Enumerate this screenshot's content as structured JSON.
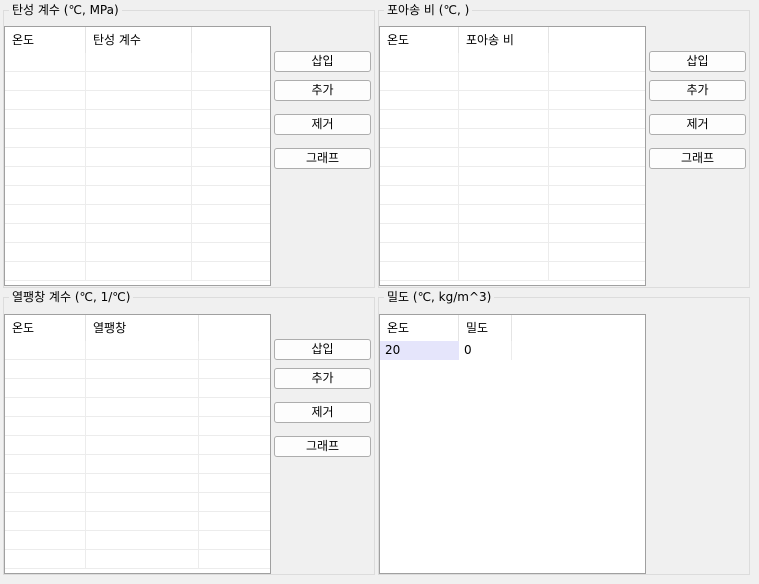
{
  "panels": {
    "elastic": {
      "title": "탄성 계수 (℃, MPa)",
      "columns": [
        "온도",
        "탄성 계수",
        ""
      ],
      "buttons": {
        "insert": "삽입",
        "add": "추가",
        "remove": "제거",
        "graph": "그래프"
      }
    },
    "poisson": {
      "title": "포아송 비 (℃, )",
      "columns": [
        "온도",
        "포아송 비",
        ""
      ],
      "buttons": {
        "insert": "삽입",
        "add": "추가",
        "remove": "제거",
        "graph": "그래프"
      }
    },
    "thermal": {
      "title": "열팽창 계수 (℃, 1/℃)",
      "columns": [
        "온도",
        "열팽창",
        ""
      ],
      "buttons": {
        "insert": "삽입",
        "add": "추가",
        "remove": "제거",
        "graph": "그래프"
      }
    },
    "density": {
      "title": "밀도 (℃, kg/m^3)",
      "columns": [
        "온도",
        "밀도",
        ""
      ],
      "rows": [
        [
          "20",
          "0",
          ""
        ]
      ]
    }
  }
}
